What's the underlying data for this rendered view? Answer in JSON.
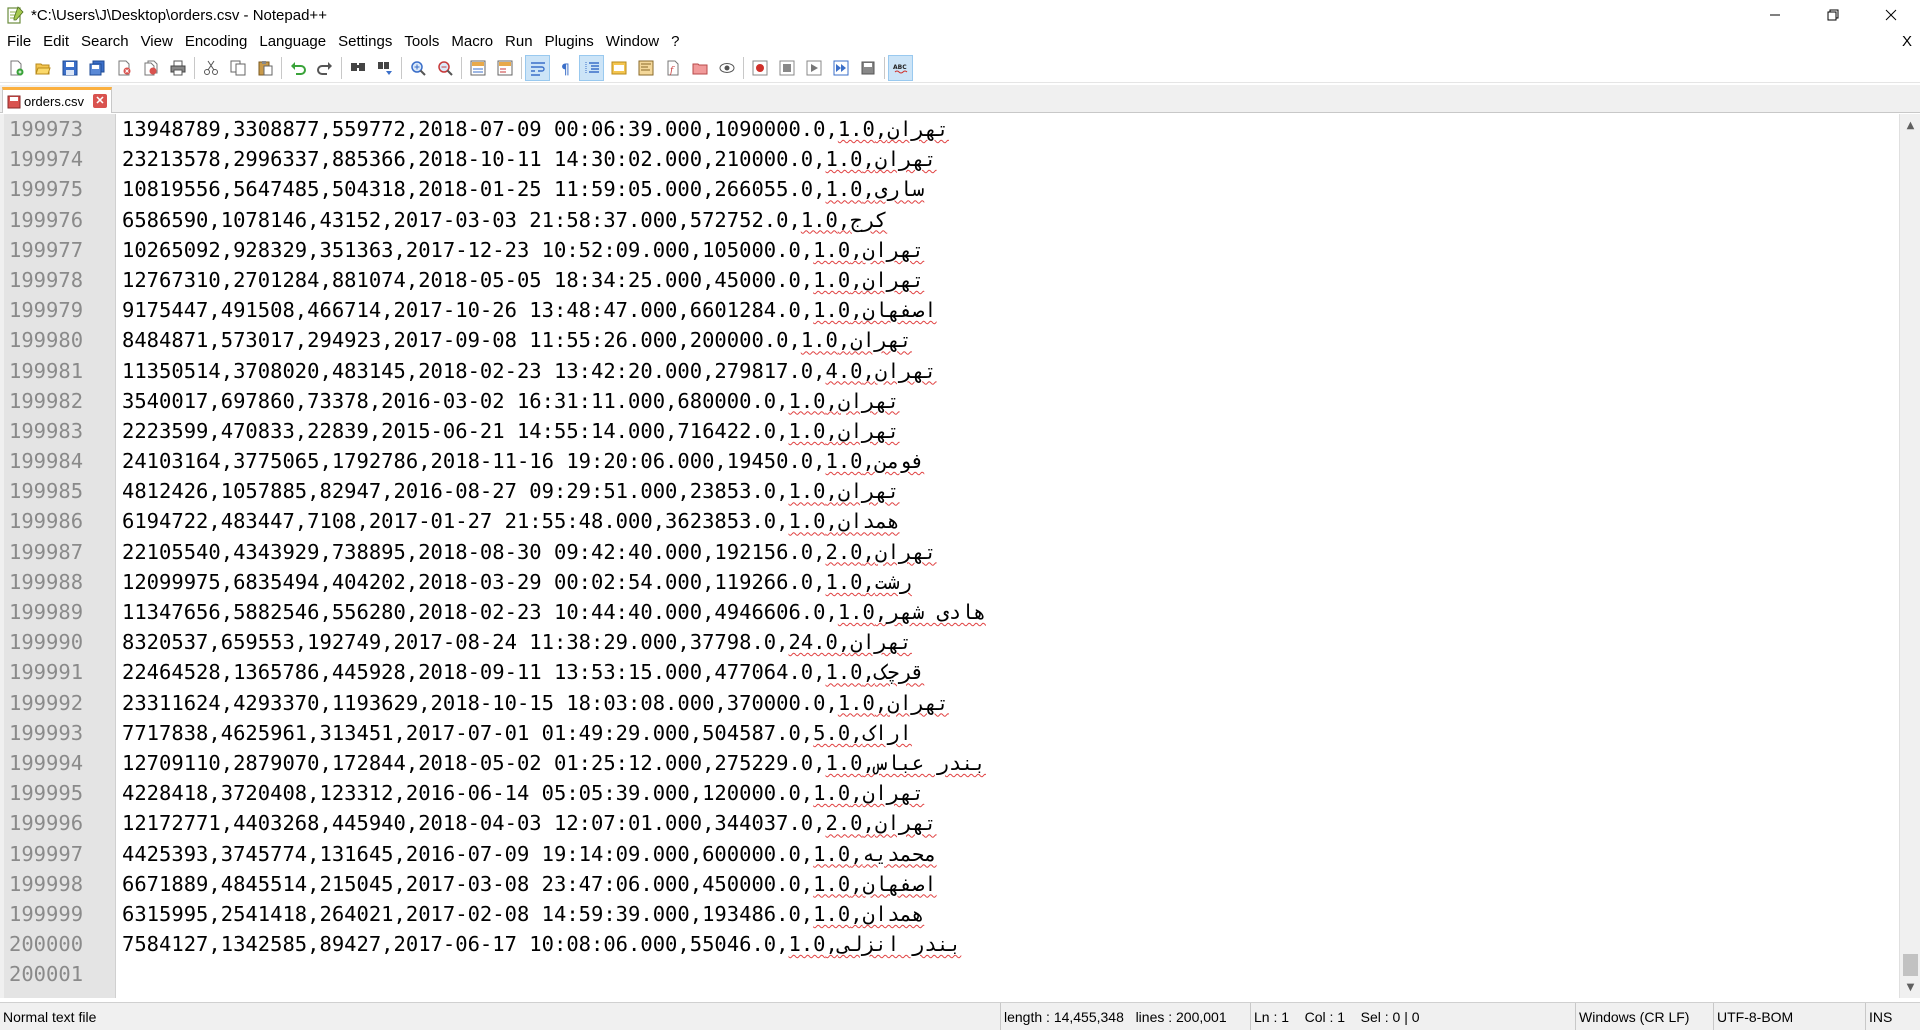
{
  "window": {
    "title": "*C:\\Users\\J\\Desktop\\orders.csv - Notepad++",
    "minimize_glyph": "—",
    "restore_glyph": "❐",
    "close_glyph": "✕"
  },
  "menu": {
    "items": [
      "File",
      "Edit",
      "Search",
      "View",
      "Encoding",
      "Language",
      "Settings",
      "Tools",
      "Macro",
      "Run",
      "Plugins",
      "Window",
      "?"
    ],
    "close_label": "X"
  },
  "toolbar": {
    "buttons": [
      "new-file-icon",
      "open-file-icon",
      "save-icon",
      "save-all-icon",
      "close-icon",
      "close-all-icon",
      "print-icon",
      "cut-icon",
      "copy-icon",
      "paste-icon",
      "undo-icon",
      "redo-icon",
      "find-icon",
      "replace-icon",
      "zoom-in-icon",
      "zoom-out-icon",
      "sync-vertical-icon",
      "sync-horizontal-icon",
      "word-wrap-icon",
      "show-all-chars-icon",
      "indent-guide-icon",
      "language-define-icon",
      "document-map-icon",
      "function-list-icon",
      "folder-workspace-icon",
      "monitoring-icon",
      "record-macro-icon",
      "stop-record-icon",
      "playback-macro-icon",
      "run-macro-multiple-icon",
      "save-macro-icon",
      "spell-check-icon"
    ]
  },
  "tab": {
    "label": "orders.csv",
    "close_label": "✕"
  },
  "editor": {
    "lines": [
      {
        "num": "199973",
        "data": "13948789,3308877,559772,2018-07-09 00:06:39.000,1090000.0,",
        "q": "1.0",
        "city": ",تهران"
      },
      {
        "num": "199974",
        "data": "23213578,2996337,885366,2018-10-11 14:30:02.000,210000.0,",
        "q": "1.0",
        "city": ",تهران"
      },
      {
        "num": "199975",
        "data": "10819556,5647485,504318,2018-01-25 11:59:05.000,266055.0,",
        "q": "1.0",
        "city": ",ساری"
      },
      {
        "num": "199976",
        "data": "6586590,1078146,43152,2017-03-03 21:58:37.000,572752.0,",
        "q": "1.0",
        "city": ",کرج"
      },
      {
        "num": "199977",
        "data": "10265092,928329,351363,2017-12-23 10:52:09.000,105000.0,",
        "q": "1.0",
        "city": ",تهران"
      },
      {
        "num": "199978",
        "data": "12767310,2701284,881074,2018-05-05 18:34:25.000,45000.0,",
        "q": "1.0",
        "city": ",تهران"
      },
      {
        "num": "199979",
        "data": "9175447,491508,466714,2017-10-26 13:48:47.000,6601284.0,",
        "q": "1.0",
        "city": ",اصفهان"
      },
      {
        "num": "199980",
        "data": "8484871,573017,294923,2017-09-08 11:55:26.000,200000.0,",
        "q": "1.0",
        "city": ",تهران"
      },
      {
        "num": "199981",
        "data": "11350514,3708020,483145,2018-02-23 13:42:20.000,279817.0,",
        "q": "4.0",
        "city": ",تهران"
      },
      {
        "num": "199982",
        "data": "3540017,697860,73378,2016-03-02 16:31:11.000,680000.0,",
        "q": "1.0",
        "city": ",تهران"
      },
      {
        "num": "199983",
        "data": "2223599,470833,22839,2015-06-21 14:55:14.000,716422.0,",
        "q": "1.0",
        "city": ",تهران"
      },
      {
        "num": "199984",
        "data": "24103164,3775065,1792786,2018-11-16 19:20:06.000,19450.0,",
        "q": "1.0",
        "city": ",فومن"
      },
      {
        "num": "199985",
        "data": "4812426,1057885,82947,2016-08-27 09:29:51.000,23853.0,",
        "q": "1.0",
        "city": ",تهران"
      },
      {
        "num": "199986",
        "data": "6194722,483447,7108,2017-01-27 21:55:48.000,3623853.0,",
        "q": "1.0",
        "city": ",همدان"
      },
      {
        "num": "199987",
        "data": "22105540,4343929,738895,2018-08-30 09:42:40.000,192156.0,",
        "q": "2.0",
        "city": ",تهران"
      },
      {
        "num": "199988",
        "data": "12099975,6835494,404202,2018-03-29 00:02:54.000,119266.0,",
        "q": "1.0",
        "city": ",رشت"
      },
      {
        "num": "199989",
        "data": "11347656,5882546,556280,2018-02-23 10:44:40.000,4946606.0,",
        "q": "1.0",
        "city": ",هادی شهر"
      },
      {
        "num": "199990",
        "data": "8320537,659553,192749,2017-08-24 11:38:29.000,37798.0,",
        "q": "24.0",
        "city": ",تهران"
      },
      {
        "num": "199991",
        "data": "22464528,1365786,445928,2018-09-11 13:53:15.000,477064.0,",
        "q": "1.0",
        "city": ",قرچک"
      },
      {
        "num": "199992",
        "data": "23311624,4293370,1193629,2018-10-15 18:03:08.000,370000.0,",
        "q": "1.0",
        "city": ",تهران"
      },
      {
        "num": "199993",
        "data": "7717838,4625961,313451,2017-07-01 01:49:29.000,504587.0,",
        "q": "5.0",
        "city": ",اراک"
      },
      {
        "num": "199994",
        "data": "12709110,2879070,172844,2018-05-02 01:25:12.000,275229.0,",
        "q": "1.0",
        "city": ",بندر عباس"
      },
      {
        "num": "199995",
        "data": "4228418,3720408,123312,2016-06-14 05:05:39.000,120000.0,",
        "q": "1.0",
        "city": ",تهران"
      },
      {
        "num": "199996",
        "data": "12172771,4403268,445940,2018-04-03 12:07:01.000,344037.0,",
        "q": "2.0",
        "city": ",تهران"
      },
      {
        "num": "199997",
        "data": "4425393,3745774,131645,2016-07-09 19:14:09.000,600000.0,",
        "q": "1.0",
        "city": ",محمدیه"
      },
      {
        "num": "199998",
        "data": "6671889,4845514,215045,2017-03-08 23:47:06.000,450000.0,",
        "q": "1.0",
        "city": ",اصفهان"
      },
      {
        "num": "199999",
        "data": "6315995,2541418,264021,2017-02-08 14:59:39.000,193486.0,",
        "q": "1.0",
        "city": ",همدان"
      },
      {
        "num": "200000",
        "data": "7584127,1342585,89427,2017-06-17 10:08:06.000,55046.0,",
        "q": "1.0",
        "city": ",بندر انزلی"
      },
      {
        "num": "200001",
        "data": "",
        "q": "",
        "city": ""
      }
    ]
  },
  "statusbar": {
    "file_type": "Normal text file",
    "length": "length : 14,455,348",
    "lines": "lines : 200,001",
    "ln": "Ln : 1",
    "col": "Col : 1",
    "sel": "Sel : 0 | 0",
    "eol": "Windows (CR LF)",
    "encoding": "UTF-8-BOM",
    "mode": "INS"
  }
}
